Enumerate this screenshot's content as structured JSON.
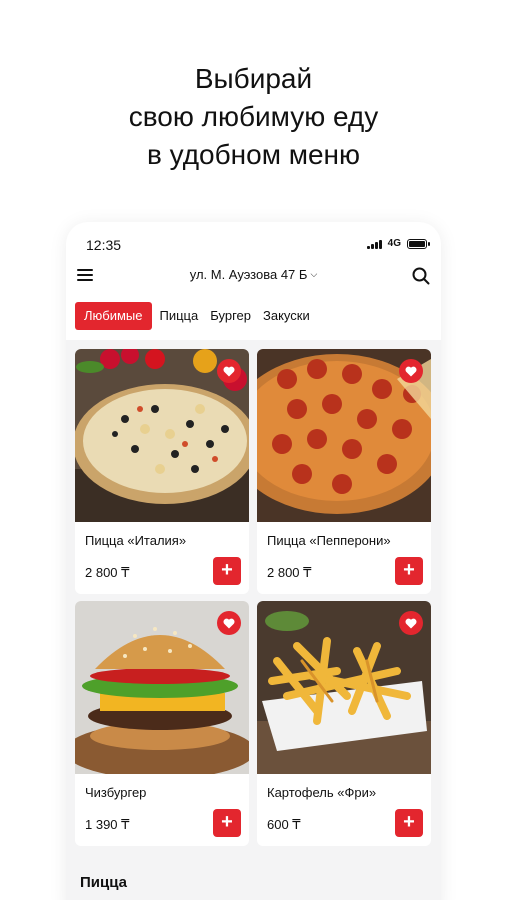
{
  "promo": {
    "line1": "Выбирай",
    "line2": "свою любимую еду",
    "line3": "в удобном меню"
  },
  "status": {
    "time": "12:35",
    "network": "4G"
  },
  "header": {
    "address": "ул. М. Ауэзова 47 Б"
  },
  "tabs": [
    {
      "label": "Любимые",
      "active": true
    },
    {
      "label": "Пицца",
      "active": false
    },
    {
      "label": "Бургер",
      "active": false
    },
    {
      "label": "Закуски",
      "active": false
    }
  ],
  "products": [
    {
      "name": "Пицца «Италия»",
      "price": "2 800 ₸",
      "image": "pizza-italia-image"
    },
    {
      "name": "Пицца «Пепперони»",
      "price": "2 800 ₸",
      "image": "pizza-pepperoni-image"
    },
    {
      "name": "Чизбургер",
      "price": "1 390 ₸",
      "image": "cheeseburger-image"
    },
    {
      "name": "Картофель «Фри»",
      "price": "600 ₸",
      "image": "french-fries-image"
    }
  ],
  "add_label": "+",
  "section": {
    "title": "Пицца"
  },
  "colors": {
    "accent": "#e3262e",
    "background": "#f4f4f5"
  }
}
